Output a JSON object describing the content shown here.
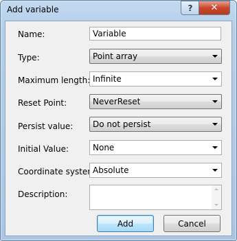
{
  "window": {
    "title": "Add variable",
    "help_label": "?",
    "close_label": "✕"
  },
  "form": {
    "name": {
      "label": "Name:",
      "value": "Variable"
    },
    "type": {
      "label": "Type:",
      "value": "Point array"
    },
    "max_length": {
      "label": "Maximum length:",
      "value": "Infinite"
    },
    "reset_point": {
      "label": "Reset Point:",
      "value": "NeverReset"
    },
    "persist_value": {
      "label": "Persist value:",
      "value": "Do not persist"
    },
    "initial_value": {
      "label": "Initial Value:",
      "value": "None"
    },
    "coordinate_system": {
      "label": "Coordinate system:",
      "value": "Absolute"
    },
    "description": {
      "label": "Description:",
      "value": ""
    }
  },
  "buttons": {
    "add_label": "Add",
    "cancel_label": "Cancel"
  },
  "icons": {
    "help": "help-icon",
    "close": "close-icon",
    "dropdown": "chevron-down-icon",
    "scroll_up": "scroll-up-icon",
    "scroll_down": "scroll-down-icon"
  }
}
